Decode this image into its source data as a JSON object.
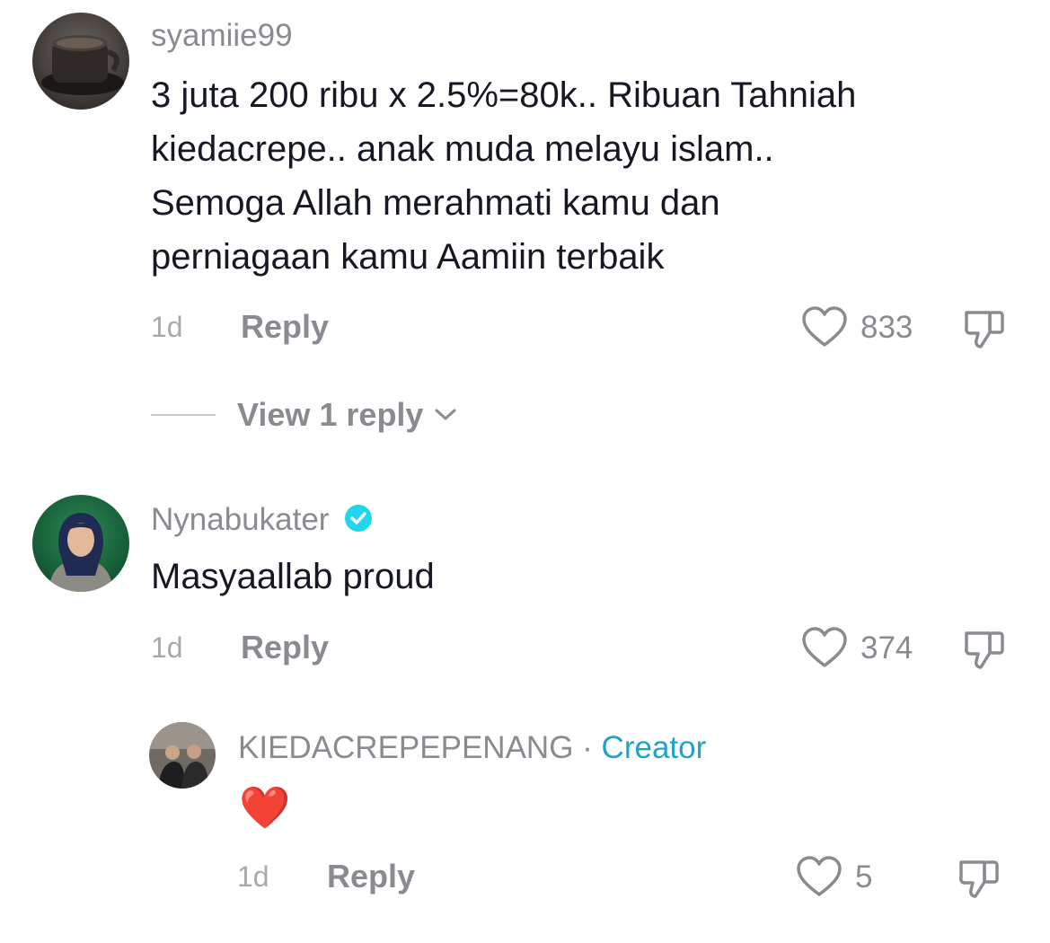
{
  "comments": [
    {
      "username": "syamiie99",
      "text": "3 juta 200 ribu x 2.5%=80k.. Ribuan Tahniah\nkiedacrepe.. anak muda melayu islam..\nSemoga Allah merahmati kamu dan\nperniagaan kamu Aamiin terbaik",
      "time": "1d",
      "reply_label": "Reply",
      "likes": "833",
      "view_replies_label": "View 1 reply"
    },
    {
      "username": "Nynabukater",
      "verified": true,
      "text": "Masyaallab proud",
      "time": "1d",
      "reply_label": "Reply",
      "likes": "374"
    }
  ],
  "reply": {
    "username": "KIEDACREPEPENANG",
    "separator": " · ",
    "creator_label": "Creator",
    "text": "❤️",
    "time": "1d",
    "reply_label": "Reply",
    "likes": "5"
  },
  "colors": {
    "text_primary": "#161823",
    "text_secondary": "#8a8b91",
    "creator_accent": "#20a3c8",
    "verified_badge": "#20d5ec",
    "heart_red": "#e8262e"
  },
  "icons": {
    "like": "heart-outline-icon",
    "dislike": "thumbs-down-icon",
    "verified": "verified-check-icon",
    "expand": "chevron-down-icon"
  }
}
